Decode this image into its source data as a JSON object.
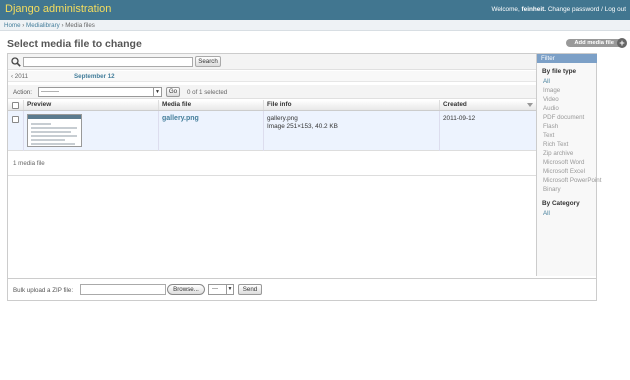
{
  "header": {
    "title": "Django administration",
    "welcome": "Welcome,",
    "username": "feinheit.",
    "change_password": "Change password",
    "separator": "/",
    "logout": "Log out"
  },
  "breadcrumbs": {
    "home": "Home",
    "sep1": "›",
    "app": "Medialibrary",
    "sep2": "›",
    "current": "Media files"
  },
  "page": {
    "title": "Select media file to change",
    "add_button": "Add media file",
    "add_plus": "+"
  },
  "search": {
    "value": "",
    "button": "Search"
  },
  "date_hierarchy": {
    "back": "‹ 2011",
    "current": "September 12"
  },
  "actions": {
    "label": "Action:",
    "selected": "---------",
    "go": "Go",
    "counter": "0 of 1 selected"
  },
  "table": {
    "columns": [
      "Preview",
      "Media file",
      "File info",
      "Created"
    ],
    "rows": [
      {
        "media_file": "gallery.png",
        "info_line1": "gallery.png",
        "info_line2": "Image 251×153, 40.2 KB",
        "created": "2011-09-12"
      }
    ]
  },
  "paginator": "1 media file",
  "filter": {
    "title": "Filter",
    "file_type_heading": "By file type",
    "file_types": [
      "All",
      "Image",
      "Video",
      "Audio",
      "PDF document",
      "Flash",
      "Text",
      "Rich Text",
      "Zip archive",
      "Microsoft Word",
      "Microsoft Excel",
      "Microsoft PowerPoint",
      "Binary"
    ],
    "category_heading": "By Category",
    "categories": [
      "All"
    ]
  },
  "upload": {
    "label": "Bulk upload a ZIP file:",
    "browse": "Browse...",
    "category_value": "---",
    "send": "Send"
  },
  "colors": {
    "header_bg": "#417690",
    "brand": "#f5dd5d",
    "link": "#447e9b",
    "row_selected_bg": "#edf3fe",
    "filter_title_bg": "#7ca0c7"
  }
}
